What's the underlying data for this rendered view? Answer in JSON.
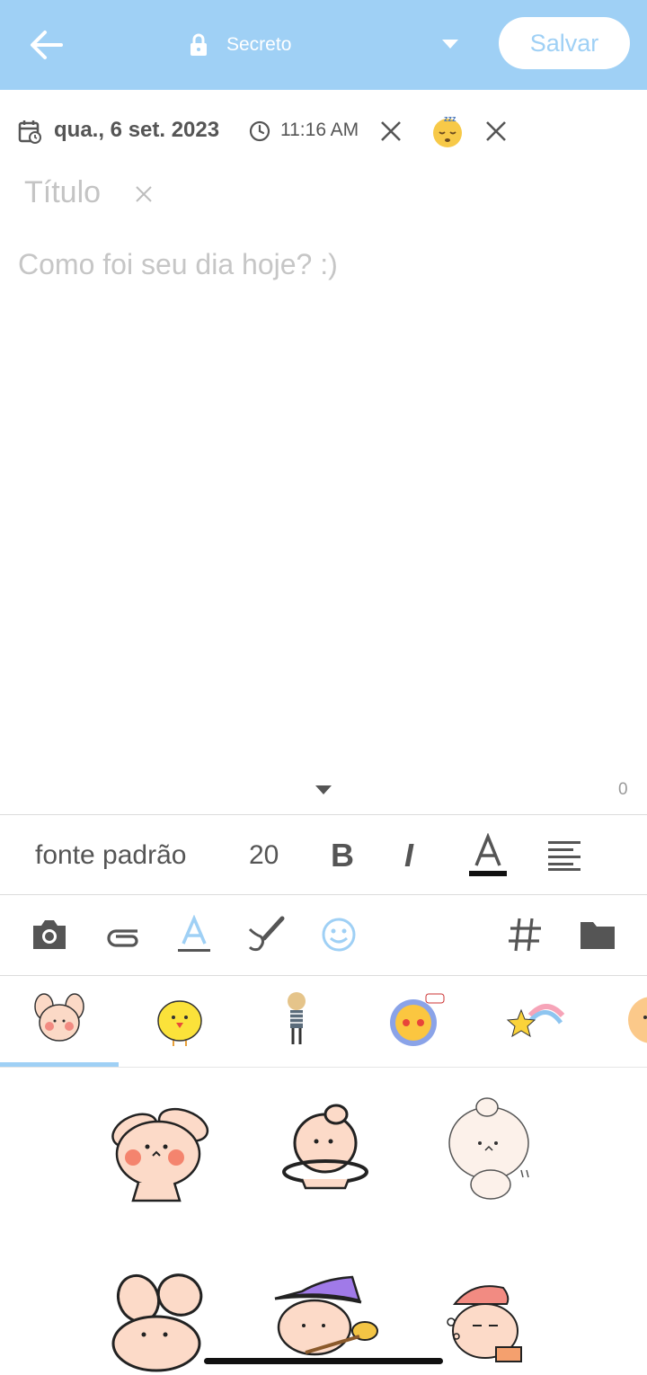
{
  "header": {
    "privacy_label": "Secreto",
    "save_label": "Salvar",
    "bg_color": "#9fd0f5"
  },
  "meta": {
    "date": "qua., 6 set. 2023",
    "time": "11:16 AM",
    "mood_icon": "sleeping-face-icon"
  },
  "editor": {
    "title_placeholder": "Título",
    "body_placeholder": "Como foi seu dia hoje? :)",
    "char_count": "0"
  },
  "format": {
    "font_name": "fonte padrão",
    "font_size": "20",
    "bold_label": "B",
    "italic_label": "I"
  },
  "tools": [
    "camera-icon",
    "attachment-icon",
    "text-color-icon",
    "brush-icon",
    "emoji-icon",
    "hashtag-icon",
    "folder-icon"
  ],
  "sticker_tabs": [
    "bunny-sticker-pack",
    "chick-sticker-pack",
    "girl-sticker-pack",
    "blush-face-sticker-pack",
    "shooting-star-sticker-pack",
    "peach-sticker-pack"
  ],
  "accent_color": "#9fd0f5"
}
